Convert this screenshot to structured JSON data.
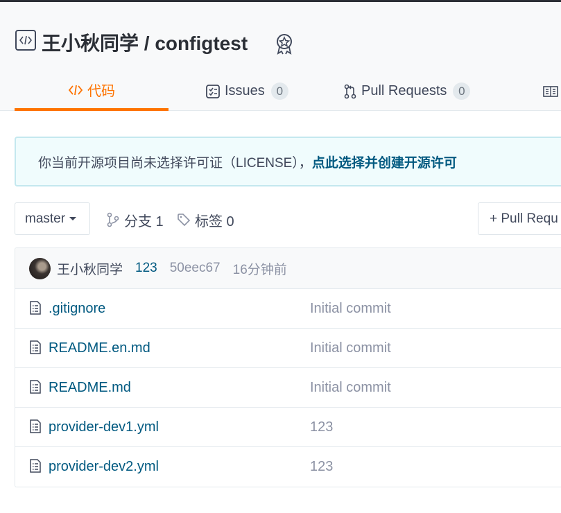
{
  "repo": {
    "owner": "王小秋同学",
    "separator": " / ",
    "name": "configtest"
  },
  "tabs": [
    {
      "label": "代码",
      "icon": "code-icon",
      "active": true
    },
    {
      "label": "Issues",
      "icon": "issues-icon",
      "count": "0"
    },
    {
      "label": "Pull Requests",
      "icon": "pull-request-icon",
      "count": "0"
    },
    {
      "label": "",
      "icon": "wiki-icon"
    }
  ],
  "notice": {
    "text": "你当前开源项目尚未选择许可证（LICENSE），",
    "link": "点此选择并创建开源许可"
  },
  "toolbar": {
    "branch": "master",
    "branches_label": "分支 1",
    "tags_label": "标签 0",
    "pr_button": "+ Pull Requ"
  },
  "latest_commit": {
    "author": "王小秋同学",
    "message": "123",
    "hash": "50eec67",
    "time": "16分钟前"
  },
  "files": [
    {
      "name": ".gitignore",
      "commit": "Initial commit"
    },
    {
      "name": "README.en.md",
      "commit": "Initial commit"
    },
    {
      "name": "README.md",
      "commit": "Initial commit"
    },
    {
      "name": "provider-dev1.yml",
      "commit": "123"
    },
    {
      "name": "provider-dev2.yml",
      "commit": "123"
    }
  ],
  "colors": {
    "accent": "#fe7300",
    "link": "#005980",
    "muted": "#8c92a4"
  }
}
